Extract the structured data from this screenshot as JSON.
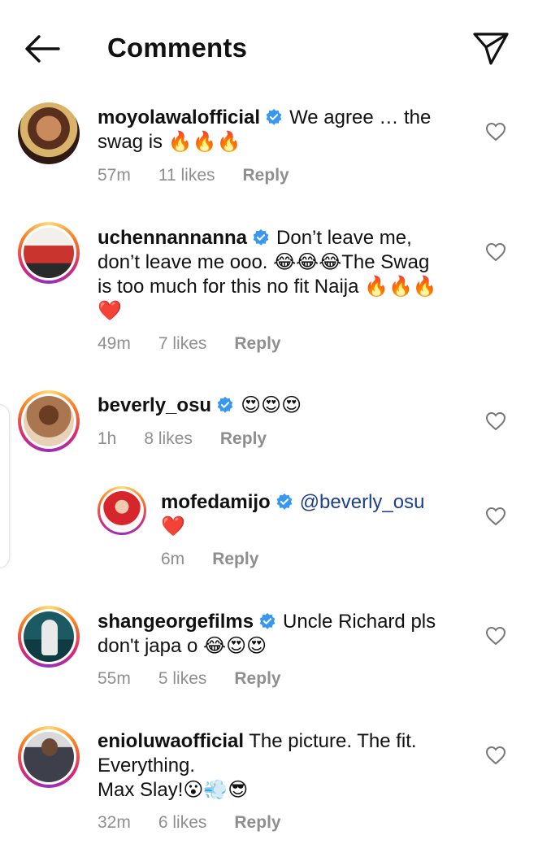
{
  "header": {
    "title": "Comments",
    "back_icon": "arrow-left-icon",
    "send_icon": "paper-plane-icon"
  },
  "colors": {
    "verified": "#3897f0",
    "meta": "#8e8e8e",
    "mention": "#1c3f8f"
  },
  "comments": [
    {
      "username": "moyolawalofficial",
      "verified": true,
      "text_lines": [
        "We agree … the",
        "swag is 🔥🔥🔥"
      ],
      "time": "57m",
      "likes": "11 likes",
      "reply": "Reply"
    },
    {
      "username": "uchennannanna",
      "verified": true,
      "text_lines": [
        "Don’t leave me,",
        "don’t leave me ooo. 😂😂😂The Swag",
        "is too much for this no fit Naija 🔥🔥🔥",
        "❤️"
      ],
      "time": "49m",
      "likes": "7 likes",
      "reply": "Reply"
    },
    {
      "username": "beverly_osu",
      "verified": true,
      "text_lines": [
        "😍😍😍"
      ],
      "time": "1h",
      "likes": "8 likes",
      "reply": "Reply"
    },
    {
      "username": "mofedamijo",
      "verified": true,
      "mention": "@beverly_osu",
      "text_lines": [
        "❤️"
      ],
      "time": "6m",
      "reply": "Reply"
    },
    {
      "username": "shangeorgefilms",
      "verified": true,
      "text_lines": [
        "Uncle Richard pls",
        "don't japa o 😂😍😍"
      ],
      "time": "55m",
      "likes": "5 likes",
      "reply": "Reply"
    },
    {
      "username": "enioluwaofficial",
      "verified": false,
      "text_lines": [
        "The picture. The fit.",
        "Everything.",
        "Max Slay!😮💨😎"
      ],
      "time": "32m",
      "likes": "6 likes",
      "reply": "Reply"
    }
  ]
}
